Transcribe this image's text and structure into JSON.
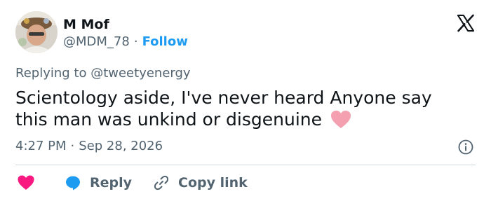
{
  "author": {
    "display_name": "M Mof",
    "handle": "@MDM_78",
    "separator": "·",
    "follow_label": "Follow"
  },
  "reply_context": {
    "prefix": "Replying to ",
    "mention": "@tweetyenergy"
  },
  "tweet": {
    "text": "Scientology aside, I've never heard Anyone say this man was unkind or disgenuine ",
    "time": "4:27 PM",
    "separator": "·",
    "date": "Sep 28, 2026"
  },
  "actions": {
    "reply_label": "Reply",
    "copy_link_label": "Copy link"
  },
  "icons": {
    "brand": "x-logo-icon",
    "emoji": "pink-heart-emoji-icon",
    "info": "info-icon",
    "like": "heart-icon",
    "reply": "speech-bubble-icon",
    "copy_link": "link-icon"
  },
  "colors": {
    "accent": "#1d9bf0",
    "like": "#f91880",
    "secondary_text": "#536471",
    "primary_text": "#0f1419",
    "emoji_heart": "#f4a0b0"
  }
}
